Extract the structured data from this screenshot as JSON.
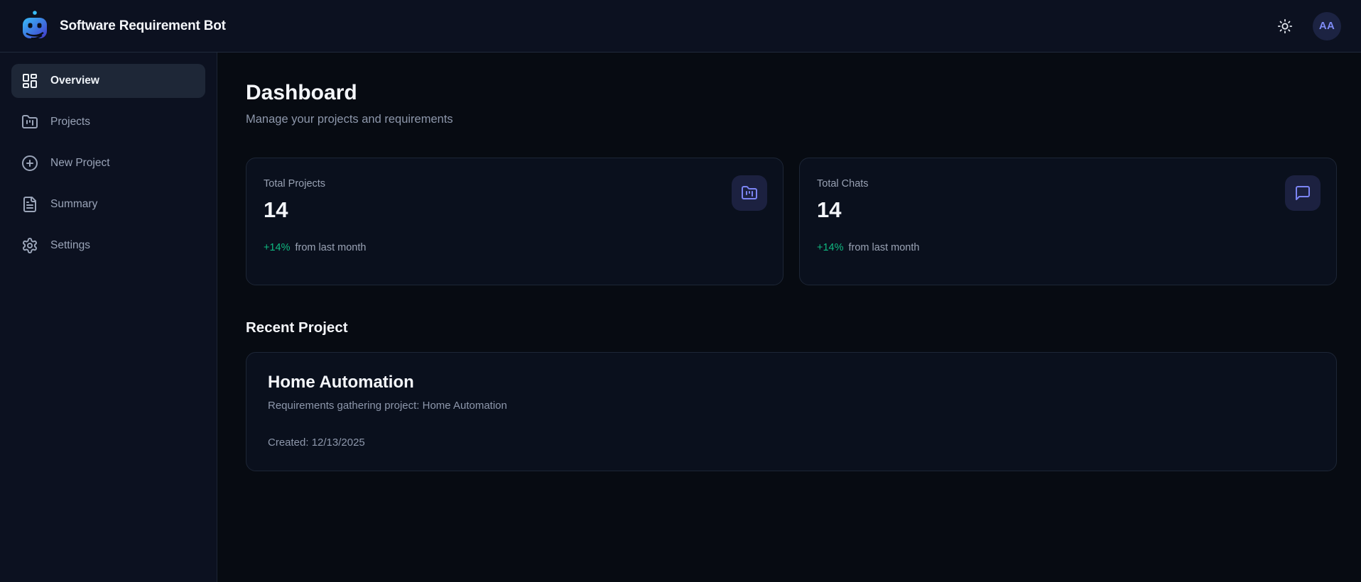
{
  "header": {
    "app_title": "Software Requirement Bot",
    "avatar_initials": "AA"
  },
  "sidebar": {
    "items": [
      {
        "label": "Overview",
        "icon": "layout-dashboard-icon",
        "active": true
      },
      {
        "label": "Projects",
        "icon": "folder-kanban-icon",
        "active": false
      },
      {
        "label": "New Project",
        "icon": "circle-plus-icon",
        "active": false
      },
      {
        "label": "Summary",
        "icon": "file-text-icon",
        "active": false
      },
      {
        "label": "Settings",
        "icon": "gear-icon",
        "active": false
      }
    ]
  },
  "main": {
    "page_title": "Dashboard",
    "page_subtitle": "Manage your projects and requirements",
    "stats": [
      {
        "label": "Total Projects",
        "value": "14",
        "delta": "+14%",
        "delta_suffix": "from last month",
        "icon": "folder-kanban-icon"
      },
      {
        "label": "Total Chats",
        "value": "14",
        "delta": "+14%",
        "delta_suffix": "from last month",
        "icon": "message-square-icon"
      }
    ],
    "recent": {
      "heading": "Recent Project",
      "project": {
        "title": "Home Automation",
        "description": "Requirements gathering project: Home Automation",
        "created": "Created: 12/13/2025"
      }
    }
  },
  "colors": {
    "accent_indigo": "#7c85f4",
    "success_green": "#10b981",
    "panel_background": "#0c1120",
    "card_background": "#0a101d",
    "main_background": "#070b12"
  }
}
